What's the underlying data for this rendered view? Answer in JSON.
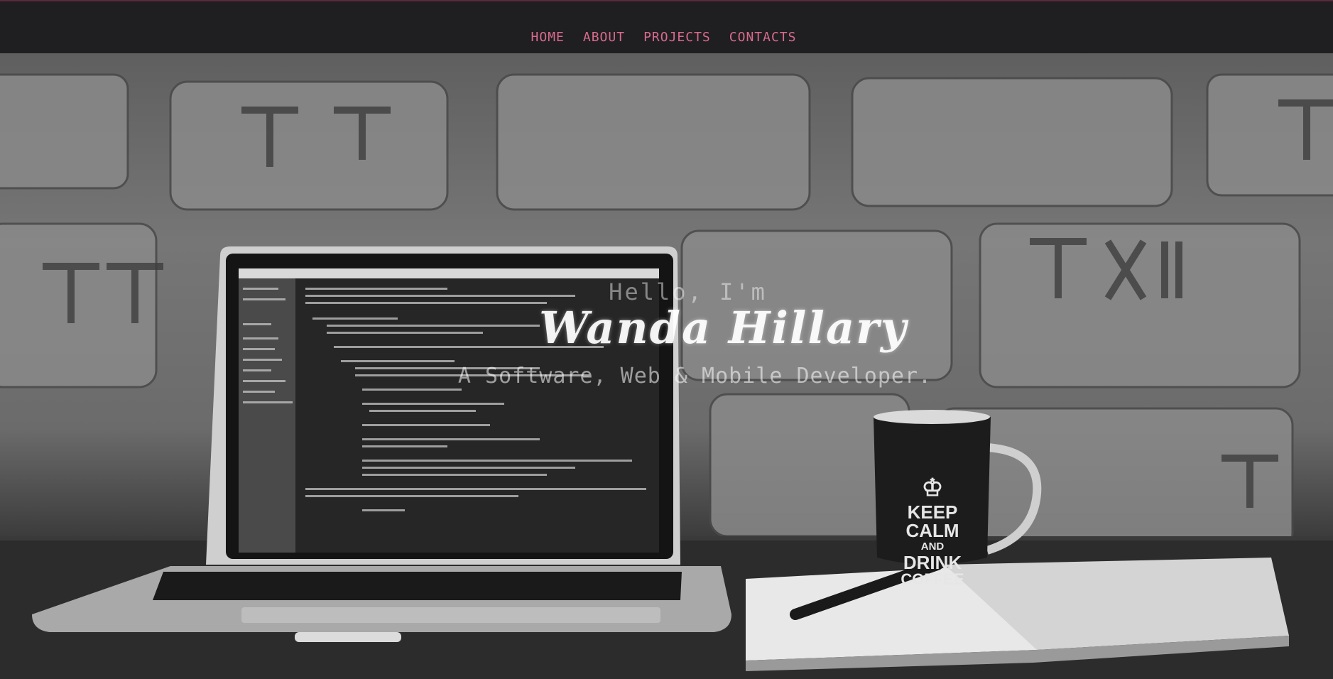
{
  "nav": {
    "items": [
      {
        "label": "HOME"
      },
      {
        "label": "ABOUT"
      },
      {
        "label": "PROJECTS"
      },
      {
        "label": "CONTACTS"
      }
    ]
  },
  "hero": {
    "greeting": "Hello, I'm",
    "name": "Wanda Hillary",
    "tagline": "A Software, Web & Mobile Developer."
  },
  "mug": {
    "lines": [
      "KEEP",
      "CALM",
      "AND",
      "DRINK",
      "COFFEE"
    ]
  },
  "colors": {
    "nav_link": "#d86b8e",
    "topbar": "#1f1e20"
  }
}
